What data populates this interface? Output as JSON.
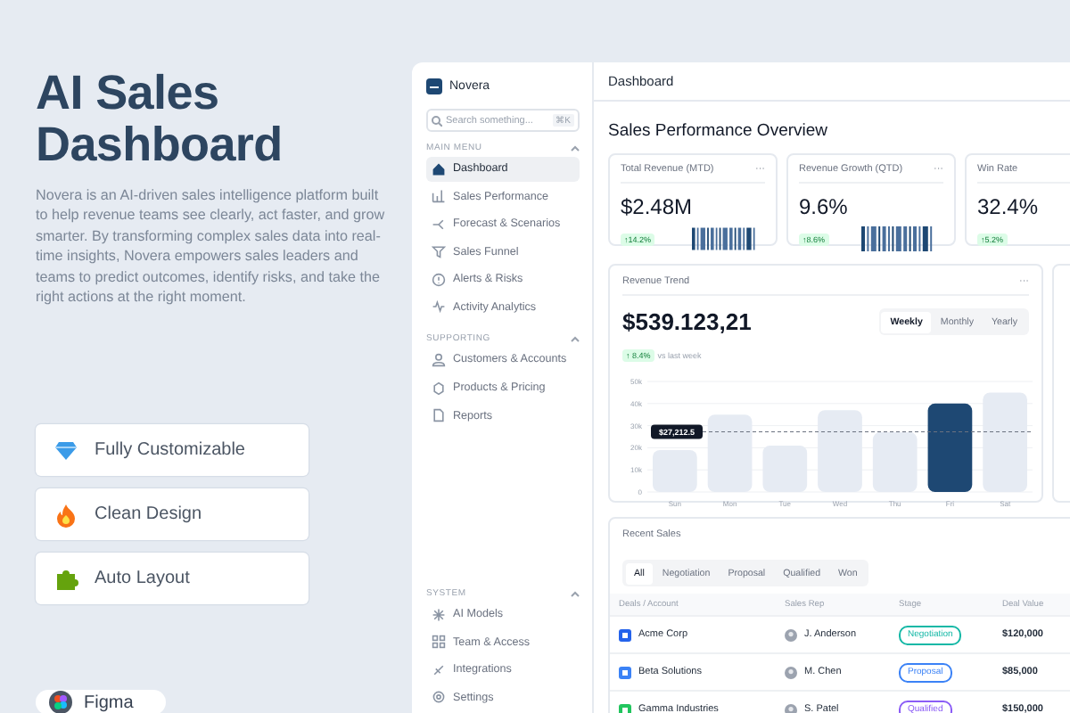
{
  "promo": {
    "title": "AI Sales Dashboard",
    "description": "Novera is an AI-driven sales intelligence platform built to help revenue teams see clearly, act faster, and grow smarter. By transforming complex sales data into real-time insights, Novera empowers sales leaders and teams to predict outcomes, identify risks, and take the right actions at the right moment.",
    "features": [
      {
        "kind": "gem",
        "label": "Fully Customizable"
      },
      {
        "kind": "flame",
        "label": "Clean Design"
      },
      {
        "kind": "puzzle",
        "label": "Auto Layout"
      }
    ],
    "tool": "Figma"
  },
  "sidebar": {
    "brand": "Novera",
    "search": {
      "placeholder": "Search something...",
      "shortcut": "⌘K"
    },
    "sections": [
      {
        "title": "MAIN MENU",
        "expanded": true,
        "items": [
          {
            "label": "Dashboard",
            "selected": true
          },
          {
            "label": "Sales Performance",
            "selected": false
          },
          {
            "label": "Forecast & Scenarios",
            "selected": false
          },
          {
            "label": "Sales Funnel",
            "selected": false
          },
          {
            "label": "Alerts & Risks",
            "selected": false
          },
          {
            "label": "Activity Analytics",
            "selected": false
          }
        ]
      },
      {
        "title": "SUPPORTING",
        "expanded": true,
        "items": [
          {
            "label": "Customers & Accounts",
            "selected": false
          },
          {
            "label": "Products & Pricing",
            "selected": false
          },
          {
            "label": "Reports",
            "selected": false
          }
        ]
      },
      {
        "title": "SYSTEM",
        "expanded": true,
        "items": [
          {
            "label": "AI Models",
            "selected": false
          },
          {
            "label": "Team & Access",
            "selected": false
          },
          {
            "label": "Integrations",
            "selected": false
          },
          {
            "label": "Settings",
            "selected": false
          }
        ]
      }
    ]
  },
  "main": {
    "page_title": "Dashboard",
    "section_title": "Sales Performance Overview",
    "stats": [
      {
        "label": "Total Revenue (MTD)",
        "menu": "···",
        "value": "$2.48M",
        "change": "↑14.2%",
        "sparkline": true
      },
      {
        "label": "Revenue Growth (QTD)",
        "menu": "···",
        "value": "9.6%",
        "change": "↑8.6%",
        "sparkline": true
      },
      {
        "label": "Win Rate",
        "value": "32.4%",
        "change": "↑5.2%",
        "sparkline": false
      }
    ],
    "revenue_trend": {
      "title": "Revenue Trend",
      "menu": "···",
      "value": "$539.123,21",
      "change": "↑ 8.4%",
      "comparison": "vs last week",
      "periods": [
        {
          "label": "Weekly",
          "selected": true
        },
        {
          "label": "Monthly",
          "selected": false
        },
        {
          "label": "Yearly",
          "selected": false
        }
      ],
      "chart_data": {
        "type": "bar",
        "categories": [
          "Sun",
          "Mon",
          "Tue",
          "Wed",
          "Thu",
          "Fri",
          "Sat"
        ],
        "stacked": true,
        "grid": true,
        "series": [
          {
            "color": "#e6ebf3",
            "values": [
              19000,
              35000,
              21000,
              37000,
              27000,
              null,
              45000
            ]
          },
          {
            "color": "#1e4873",
            "values": [
              null,
              null,
              null,
              null,
              null,
              40000,
              null
            ]
          }
        ],
        "ref_lines": [
          {
            "axis": "y",
            "value": 27212.5,
            "label": "$27,212.5"
          }
        ],
        "ylim": [
          0,
          50000
        ],
        "yticks": [
          {
            "value": 0,
            "label": "0"
          },
          {
            "value": 10000,
            "label": "10k"
          },
          {
            "value": 20000,
            "label": "20k"
          },
          {
            "value": 30000,
            "label": "30k"
          },
          {
            "value": 40000,
            "label": "40k"
          },
          {
            "value": 50000,
            "label": "50k"
          }
        ]
      }
    },
    "recent_sales": {
      "title": "Recent Sales",
      "filters": [
        {
          "label": "All",
          "selected": true
        },
        {
          "label": "Negotiation",
          "selected": false
        },
        {
          "label": "Proposal",
          "selected": false
        },
        {
          "label": "Qualified",
          "selected": false
        },
        {
          "label": "Won",
          "selected": false
        }
      ],
      "columns": [
        "Deals / Account",
        "Sales Rep",
        "Stage",
        "Deal Value"
      ],
      "rows": [
        {
          "account": {
            "name": "Acme Corp",
            "color": "#2563eb"
          },
          "rep": "J. Anderson",
          "stage": {
            "label": "Negotiation",
            "color": "#14b8a6"
          },
          "value": "$120,000"
        },
        {
          "account": {
            "name": "Beta Solutions",
            "color": "#3b82f6"
          },
          "rep": "M. Chen",
          "stage": {
            "label": "Proposal",
            "color": "#3b82f6"
          },
          "value": "$85,000"
        },
        {
          "account": {
            "name": "Gamma Industries",
            "color": "#22c55e"
          },
          "rep": "S. Patel",
          "stage": {
            "label": "Qualified",
            "color": "#8b5cf6"
          },
          "value": "$150,000"
        }
      ]
    }
  }
}
